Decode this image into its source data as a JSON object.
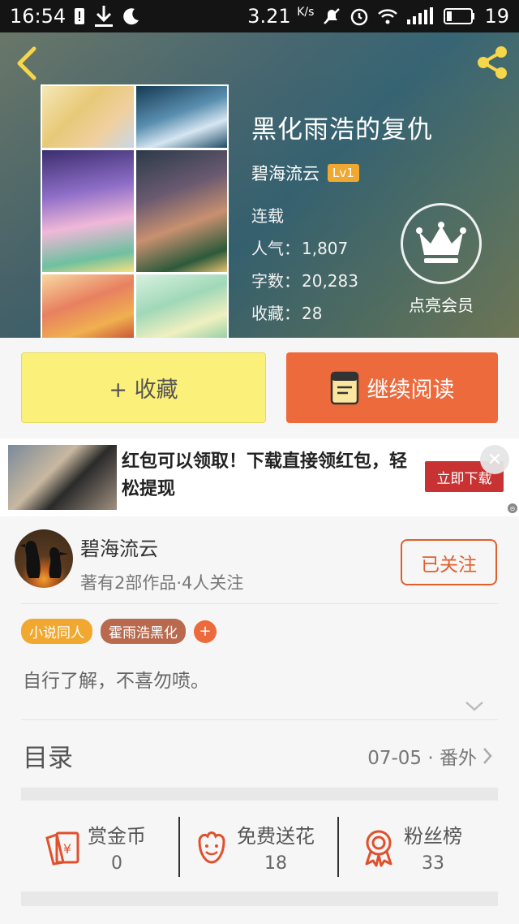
{
  "status_bar": {
    "time": "16:54",
    "speed": "3.21",
    "speed_unit": "K/s",
    "battery": "19"
  },
  "book": {
    "title": "黑化雨浩的复仇",
    "author": "碧海流云",
    "level": "Lv1",
    "status": "连载",
    "popularity_label": "人气：",
    "popularity": "1,807",
    "words_label": "字数：",
    "words": "20,283",
    "favorites_label": "收藏：",
    "favorites": "28",
    "vip_label": "点亮会员"
  },
  "actions": {
    "collect_label": "+ 收藏",
    "read_label": "继续阅读"
  },
  "ad": {
    "text": "红包可以领取！下载直接领红包，轻松提现",
    "button": "立即下载",
    "close": "✕",
    "mark": "⊝"
  },
  "author_section": {
    "name": "碧海流云",
    "sub": "著有2部作品·4人关注",
    "follow_label": "已关注"
  },
  "tags": [
    "小说同人",
    "霍雨浩黑化",
    "+"
  ],
  "description": "自行了解，不喜勿喷。",
  "toc": {
    "label": "目录",
    "latest": "07-05 · 番外"
  },
  "stats": [
    {
      "label": "赏金币",
      "value": "0",
      "icon": "reward-coin-icon"
    },
    {
      "label": "免费送花",
      "value": "18",
      "icon": "flower-icon"
    },
    {
      "label": "粉丝榜",
      "value": "33",
      "icon": "medal-icon"
    }
  ],
  "colors": {
    "accent": "#ec6a3c",
    "collect_button": "#fbf17a",
    "level_badge": "#f0a830",
    "tag_1": "#f0a830",
    "tag_2": "#b96a4e",
    "ad_button": "#c83232"
  }
}
